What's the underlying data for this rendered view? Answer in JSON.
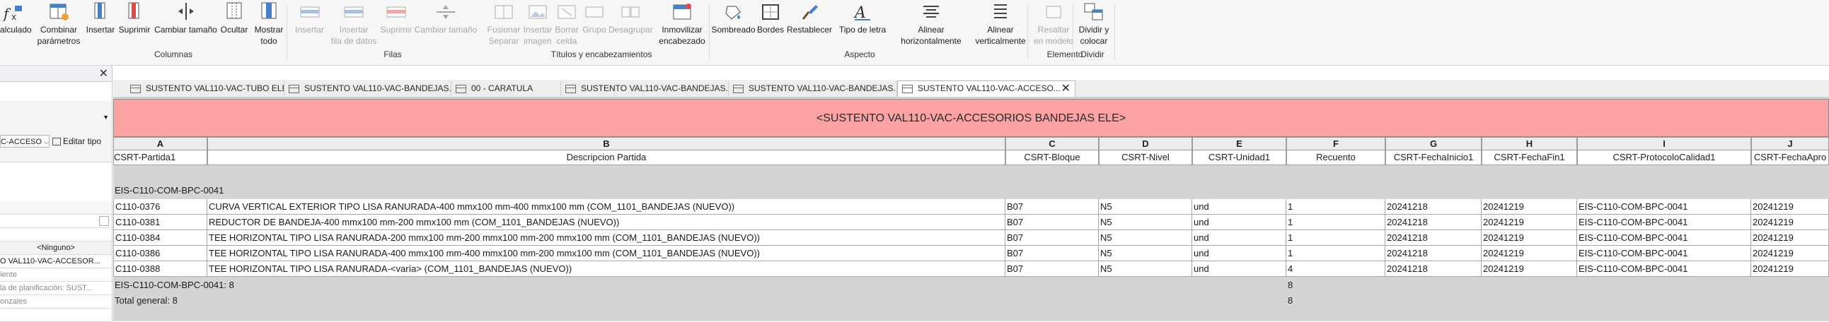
{
  "ribbon": {
    "buttons": [
      {
        "id": "calculado",
        "label": "alculado",
        "icon": "fx-icon",
        "disabled": false
      },
      {
        "id": "combinar",
        "label": "Combinar\nparámetros",
        "icon": "combine-parameters-icon",
        "disabled": false
      },
      {
        "id": "insertar",
        "label": "Insertar",
        "icon": "insert-column-icon",
        "disabled": false
      },
      {
        "id": "suprimir",
        "label": "Suprimir",
        "icon": "delete-column-icon",
        "disabled": false
      },
      {
        "id": "cambiar-tamano",
        "label": "Cambiar tamaño",
        "icon": "resize-icon",
        "disabled": false
      },
      {
        "id": "ocultar",
        "label": "Ocultar",
        "icon": "hide-icon",
        "disabled": false
      },
      {
        "id": "mostrar-todo",
        "label": "Mostrar\ntodo",
        "icon": "show-all-icon",
        "disabled": false
      },
      {
        "id": "insertar-fila",
        "label": "Insertar",
        "icon": "insert-row-icon",
        "disabled": true
      },
      {
        "id": "insertar-fila-datos",
        "label": "Insertar\nfila de datos",
        "icon": "insert-data-row-icon",
        "disabled": true
      },
      {
        "id": "suprimir-fila",
        "label": "Suprimir",
        "icon": "delete-row-icon",
        "disabled": true
      },
      {
        "id": "cambiar-tamano-fila",
        "label": "Cambiar tamaño",
        "icon": "row-resize-icon",
        "disabled": true
      },
      {
        "id": "fusionar-separar",
        "label": "Fusionar\nSeparar",
        "icon": "merge-icon",
        "disabled": true
      },
      {
        "id": "insertar-imagen",
        "label": "Insertar\nimagen",
        "icon": "insert-image-icon",
        "disabled": true
      },
      {
        "id": "borrar-celda",
        "label": "Borrar\ncelda",
        "icon": "clear-cell-icon",
        "disabled": true
      },
      {
        "id": "grupo",
        "label": "Grupo",
        "icon": "group-icon",
        "disabled": true
      },
      {
        "id": "desagrupar",
        "label": "Desagrupar",
        "icon": "ungroup-icon",
        "disabled": true
      },
      {
        "id": "inmovilizar",
        "label": "Inmovilizar\nencabezado",
        "icon": "freeze-header-icon",
        "disabled": false
      },
      {
        "id": "sombreado",
        "label": "Sombreado",
        "icon": "shading-icon",
        "disabled": false
      },
      {
        "id": "bordes",
        "label": "Bordes",
        "icon": "borders-icon",
        "disabled": false
      },
      {
        "id": "restablecer",
        "label": "Restablecer",
        "icon": "reset-brush-icon",
        "disabled": false
      },
      {
        "id": "tipo-letra",
        "label": "Tipo de letra",
        "icon": "font-icon",
        "disabled": false
      },
      {
        "id": "alinear-h",
        "label": "Alinear\nhorizontalmente",
        "icon": "align-horizontal-icon",
        "disabled": false
      },
      {
        "id": "alinear-v",
        "label": "Alinear\nverticalmente",
        "icon": "align-vertical-icon",
        "disabled": false
      },
      {
        "id": "resaltar",
        "label": "Resaltar\nen modelo",
        "icon": "highlight-in-model-icon",
        "disabled": true
      },
      {
        "id": "dividir",
        "label": "Dividir y\ncolocar",
        "icon": "split-place-icon",
        "disabled": false
      }
    ],
    "groups": [
      "Columnas",
      "Filas",
      "Títulos y encabezamientos",
      "Aspecto",
      "Elemento",
      "Dividir"
    ]
  },
  "left_panel": {
    "close": "✕",
    "type_selector": "C-ACCESO",
    "edit_type": "Editar tipo",
    "rows": [
      "<Ninguno>",
      "O VAL110-VAC-ACCESOR...",
      "iente",
      "la de planificación: SUST...",
      "onzales"
    ]
  },
  "tabs": [
    {
      "label": "SUSTENTO VAL110-VAC-TUBO ELE",
      "active": false
    },
    {
      "label": "SUSTENTO VAL110-VAC-BANDEJAS...",
      "active": false
    },
    {
      "label": "00 - CARATULA",
      "active": false
    },
    {
      "label": "SUSTENTO VAL110-VAC-BANDEJAS...",
      "active": false
    },
    {
      "label": "SUSTENTO VAL110-VAC-BANDEJAS...",
      "active": false
    },
    {
      "label": "SUSTENTO VAL110-VAC-ACCESO...",
      "active": true
    }
  ],
  "tab_close": "✕",
  "schedule": {
    "title": "<SUSTENTO VAL110-VAC-ACCESORIOS BANDEJAS ELE>",
    "columns": [
      {
        "letter": "A",
        "header": "CSRT-Partida1"
      },
      {
        "letter": "B",
        "header": "Descripcion Partida"
      },
      {
        "letter": "C",
        "header": "CSRT-Bloque"
      },
      {
        "letter": "D",
        "header": "CSRT-Nivel"
      },
      {
        "letter": "E",
        "header": "CSRT-Unidad1"
      },
      {
        "letter": "F",
        "header": "Recuento"
      },
      {
        "letter": "G",
        "header": "CSRT-FechaInicio1"
      },
      {
        "letter": "H",
        "header": "CSRT-FechaFin1"
      },
      {
        "letter": "I",
        "header": "CSRT-ProtocoloCalidad1"
      },
      {
        "letter": "J",
        "header": "CSRT-FechaApro"
      }
    ],
    "group_header": "EIS-C110-COM-BPC-0041",
    "rows": [
      [
        "C110-0376",
        "CURVA VERTICAL EXTERIOR TIPO LISA RANURADA-400 mmx100 mm-400 mmx100 mm (COM_1101_BANDEJAS (NUEVO))",
        "B07",
        "N5",
        "und",
        "1",
        "20241218",
        "20241219",
        "EIS-C110-COM-BPC-0041",
        "20241219"
      ],
      [
        "C110-0381",
        "REDUCTOR DE BANDEJA-400 mmx100 mm-200 mmx100 mm (COM_1101_BANDEJAS (NUEVO))",
        "B07",
        "N5",
        "und",
        "1",
        "20241218",
        "20241219",
        "EIS-C110-COM-BPC-0041",
        "20241219"
      ],
      [
        "C110-0384",
        "TEE HORIZONTAL TIPO LISA RANURADA-200 mmx100 mm-200 mmx100 mm-200 mmx100 mm (COM_1101_BANDEJAS (NUEVO))",
        "B07",
        "N5",
        "und",
        "1",
        "20241218",
        "20241219",
        "EIS-C110-COM-BPC-0041",
        "20241219"
      ],
      [
        "C110-0386",
        "TEE HORIZONTAL TIPO LISA RANURADA-400 mmx100 mm-400 mmx100 mm-200 mmx100 mm (COM_1101_BANDEJAS (NUEVO))",
        "B07",
        "N5",
        "und",
        "1",
        "20241218",
        "20241219",
        "EIS-C110-COM-BPC-0041",
        "20241219"
      ],
      [
        "C110-0388",
        "TEE HORIZONTAL TIPO LISA RANURADA-<varía> (COM_1101_BANDEJAS (NUEVO))",
        "B07",
        "N5",
        "und",
        "4",
        "20241218",
        "20241219",
        "EIS-C110-COM-BPC-0041",
        "20241219"
      ]
    ],
    "group_footer": {
      "label": "EIS-C110-COM-BPC-0041: 8",
      "count": "8"
    },
    "grand_total": {
      "label": "Total general: 8",
      "count": "8"
    }
  }
}
